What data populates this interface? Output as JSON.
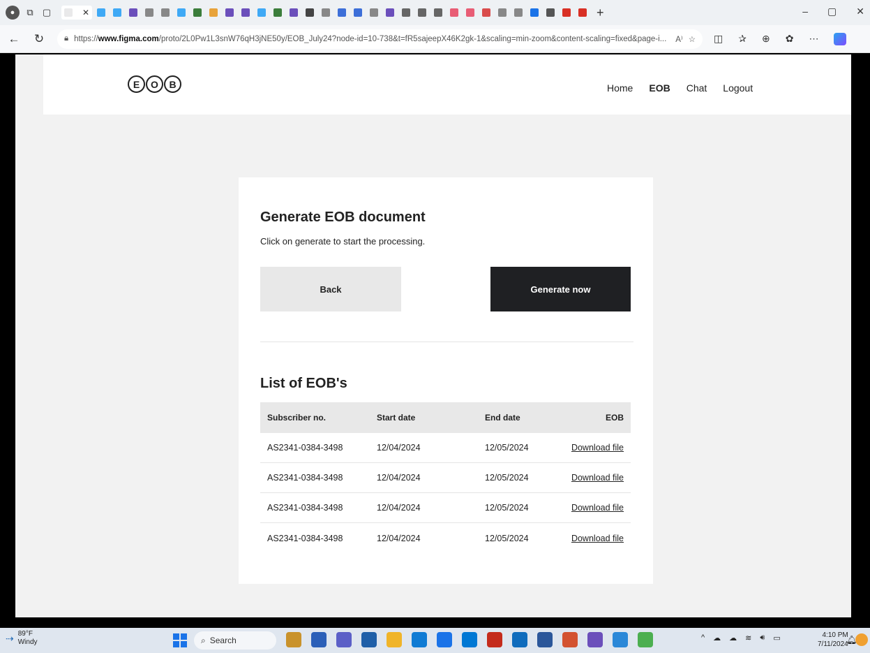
{
  "browser": {
    "url_prefix": "https://",
    "url_host": "www.figma.com",
    "url_rest": "/proto/2L0Pw1L3snW76qH3jNE50y/EOB_July24?node-id=10-738&t=fR5sajeepX46K2gk-1&scaling=min-zoom&content-scaling=fixed&page-i...",
    "tab_colors": [
      "#e9e9ea",
      "#3fa9f5",
      "#3fa9f5",
      "#6b4fbb",
      "#888",
      "#888",
      "#3fa9f5",
      "#3b7d3b",
      "#e8a33a",
      "#6b4fbb",
      "#6b4fbb",
      "#3fa9f5",
      "#3b7d3b",
      "#6b4fbb",
      "#444",
      "#888",
      "#3d6fd8",
      "#3d6fd8",
      "#888",
      "#6b4fbb",
      "#666",
      "#666",
      "#666",
      "#e85d75",
      "#e85d75",
      "#d94c4c",
      "#888",
      "#888",
      "#1a73e8",
      "#555",
      "#d93025",
      "#d93025"
    ]
  },
  "app": {
    "logo_letters": [
      "E",
      "O",
      "B"
    ],
    "nav": [
      "Home",
      "EOB",
      "Chat",
      "Logout"
    ]
  },
  "card": {
    "title": "Generate EOB document",
    "subtitle": "Click on generate to start the processing.",
    "back_label": "Back",
    "generate_label": "Generate now",
    "list_title": "List of EOB's",
    "columns": [
      "Subscriber no.",
      "Start date",
      "End date",
      "EOB"
    ],
    "rows": [
      [
        "AS2341-0384-3498",
        "12/04/2024",
        "12/05/2024",
        "Download file"
      ],
      [
        "AS2341-0384-3498",
        "12/04/2024",
        "12/05/2024",
        "Download file"
      ],
      [
        "AS2341-0384-3498",
        "12/04/2024",
        "12/05/2024",
        "Download file"
      ],
      [
        "AS2341-0384-3498",
        "12/04/2024",
        "12/05/2024",
        "Download file"
      ]
    ]
  },
  "taskbar": {
    "temperature": "89°F",
    "weather": "Windy",
    "search_label": "Search",
    "time": "4:10 PM",
    "date": "7/11/2024",
    "app_colors": [
      "#c9922b",
      "#2b5fb8",
      "#5b5fc7",
      "#1f5fa8",
      "#f0b429",
      "#0f7bd4",
      "#1a73e8",
      "#0078d4",
      "#c42b1c",
      "#0f6cbd",
      "#2b579a",
      "#d35230",
      "#6b4fbb",
      "#2b88d8",
      "#4caf50"
    ]
  }
}
